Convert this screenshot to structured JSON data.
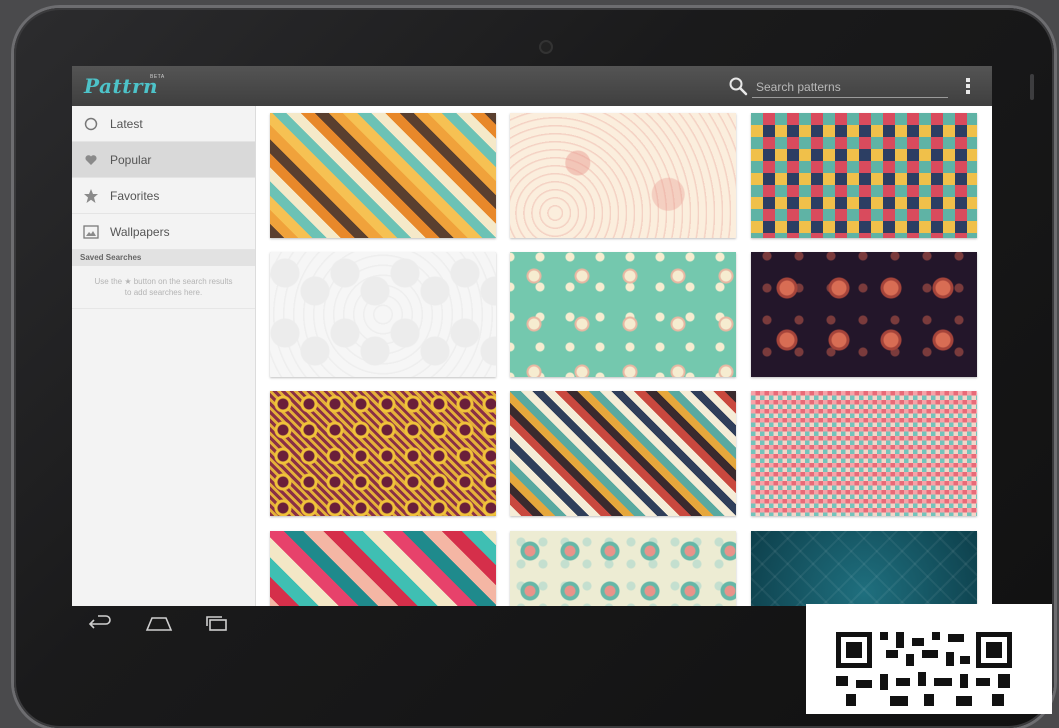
{
  "app": {
    "logo": "Pattrn",
    "beta": "BETA"
  },
  "search": {
    "placeholder": "Search patterns"
  },
  "sidebar": {
    "items": [
      {
        "label": "Latest",
        "icon": "clock-icon",
        "active": false
      },
      {
        "label": "Popular",
        "icon": "heart-icon",
        "active": true
      },
      {
        "label": "Favorites",
        "icon": "star-icon",
        "active": false
      },
      {
        "label": "Wallpapers",
        "icon": "image-icon",
        "active": false
      }
    ],
    "saved_header": "Saved Searches",
    "saved_hint": "Use the ★ button on the search results to add searches here."
  },
  "patterns": [
    {
      "name": "diagonal-stripes-warm"
    },
    {
      "name": "pink-floral-swirl"
    },
    {
      "name": "diagonal-checker"
    },
    {
      "name": "white-damask"
    },
    {
      "name": "mint-floral-vine"
    },
    {
      "name": "dark-coral-flowers"
    },
    {
      "name": "plum-gold-geometric"
    },
    {
      "name": "diagonal-stripes-retro"
    },
    {
      "name": "pink-teal-pixels"
    },
    {
      "name": "pink-teal-stripes"
    },
    {
      "name": "mint-damask"
    },
    {
      "name": "teal-plaid"
    }
  ],
  "system_nav": [
    "back-icon",
    "home-icon",
    "recent-apps-icon"
  ],
  "colors": {
    "accent": "#4dc3c9",
    "actionbar": "#4a4a4a",
    "sidebar_bg": "#f3f3f3",
    "active_item": "#d9d9d9"
  }
}
